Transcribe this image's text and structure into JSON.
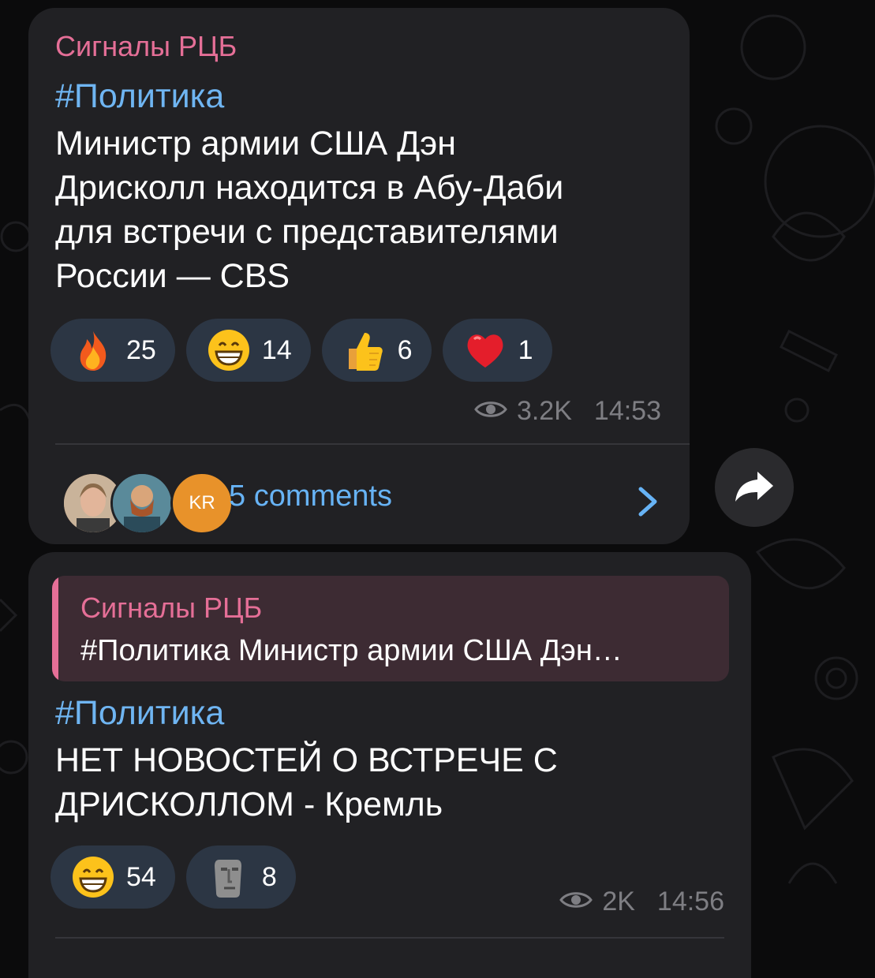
{
  "messages": [
    {
      "channel": "Сигналы РЦБ",
      "hashtag": "#Политика",
      "lines": [
        "Министр армии США Дэн",
        "Дрисколл находится в Абу-Даби",
        "для встречи с представителями",
        "России — CBS"
      ],
      "reactions": [
        {
          "emoji": "fire-emoji",
          "count": "25"
        },
        {
          "emoji": "grinning-face-emoji",
          "count": "14"
        },
        {
          "emoji": "thumbs-up-emoji",
          "count": "6"
        },
        {
          "emoji": "red-heart-emoji",
          "count": "1"
        }
      ],
      "views": "3.2K",
      "time": "14:53",
      "comments": {
        "avatar_initials": "KR",
        "label": "5 comments"
      }
    },
    {
      "reply_to": {
        "channel": "Сигналы РЦБ",
        "text": "#Политика Министр армии США Дэн…"
      },
      "hashtag": "#Политика",
      "lines": [
        "НЕТ НОВОСТЕЙ О ВСТРЕЧЕ С",
        "ДРИСКОЛЛОМ - Кремль"
      ],
      "reactions": [
        {
          "emoji": "grinning-face-emoji",
          "count": "54"
        },
        {
          "emoji": "moai-emoji",
          "count": "8"
        }
      ],
      "views": "2K",
      "time": "14:56"
    }
  ],
  "colors": {
    "accent_pink": "#e56f97",
    "link_blue": "#6fb5f2",
    "bubble": "#212124",
    "chip": "#2c3644"
  }
}
